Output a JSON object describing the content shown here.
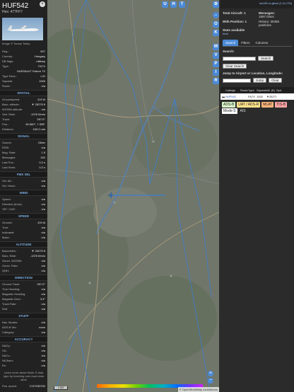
{
  "aircraft": {
    "callsign": "HUF542",
    "hex_line": "Hex:  477FF7",
    "photo_credit": "Image © Tamas Tollay",
    "details": [
      {
        "k": "Reg.:",
        "v": "607"
      },
      {
        "k": "Country:",
        "v": "Hungary"
      },
      {
        "k": "DB flags:",
        "v": "military"
      },
      {
        "k": "Type:",
        "v": "FA7X"
      },
      {
        "k": "",
        "v": "DASSAULT Falcon 7X"
      },
      {
        "k": "Type Desc.:",
        "v": "L3J"
      },
      {
        "k": "Squawk:",
        "v": "1000"
      },
      {
        "k": "Route:",
        "v": "n/a"
      }
    ]
  },
  "sections": [
    {
      "title": "SPATIAL",
      "rows": [
        {
          "k": "Groundspeed:",
          "v": "419 kt"
        },
        {
          "k": "Baro. altitude:",
          "v": "▼ 25275 ft"
        },
        {
          "k": "WGS84 altitude:",
          "v": "n/a"
        },
        {
          "k": "Vert. Rate:",
          "v": "-1376 ft/min"
        },
        {
          "k": "Track:",
          "v": "267.0°"
        },
        {
          "k": "Pos.:",
          "v": "50.560°, 7.305°"
        },
        {
          "k": "Distance:",
          "v": "163.2 nmi"
        }
      ]
    },
    {
      "title": "SIGNAL",
      "rows": [
        {
          "k": "Source:",
          "v": "Other"
        },
        {
          "k": "RSSI:",
          "v": "n/a"
        },
        {
          "k": "Msg. Rate:",
          "v": "1.5"
        },
        {
          "k": "Messages:",
          "v": "152"
        },
        {
          "k": "Last Pos.:",
          "v": "0.2 s"
        },
        {
          "k": "Last Seen:",
          "v": "0.2 s"
        }
      ]
    },
    {
      "title": "FMS SEL",
      "rows": [
        {
          "k": "Sel. Alt.:",
          "v": "n/a"
        },
        {
          "k": "Sel. Head.:",
          "v": "n/a"
        }
      ]
    },
    {
      "title": "WIND",
      "rows": [
        {
          "k": "Speed:",
          "v": "n/a"
        },
        {
          "k": "Direction (from):",
          "v": "n/a"
        },
        {
          "k": "TAT / OAT:",
          "v": "n/a"
        }
      ]
    },
    {
      "title": "SPEED",
      "rows": [
        {
          "k": "Ground:",
          "v": "419 kt"
        },
        {
          "k": "True:",
          "v": "n/a"
        },
        {
          "k": "Indicated:",
          "v": "n/a"
        },
        {
          "k": "Mach:",
          "v": "n/a"
        }
      ]
    },
    {
      "title": "ALTITUDE",
      "rows": [
        {
          "k": "Barometric:",
          "v": "▼ 25275 ft"
        },
        {
          "k": "Baro. Rate:",
          "v": "-1376 ft/min"
        },
        {
          "k": "Geom. WGS84:",
          "v": "n/a"
        },
        {
          "k": "Geom. Rate:",
          "v": "n/a"
        },
        {
          "k": "QNH:",
          "v": "n/a"
        }
      ]
    },
    {
      "title": "DIRECTION",
      "rows": [
        {
          "k": "Ground Track:",
          "v": "267.0°"
        },
        {
          "k": "True Heading:",
          "v": "n/a"
        },
        {
          "k": "Magnetic Heading:",
          "v": "n/a"
        },
        {
          "k": "Magnetic Decl.:",
          "v": "3.3°"
        },
        {
          "k": "Track Rate:",
          "v": "n/a"
        },
        {
          "k": "Roll:",
          "v": "n/a"
        }
      ]
    },
    {
      "title": "STUFF",
      "rows": [
        {
          "k": "Nav. Modes:",
          "v": "n/a"
        },
        {
          "k": "ADS-B Ver.:",
          "v": "none"
        },
        {
          "k": "Category:",
          "v": "n/a"
        }
      ]
    },
    {
      "title": "ACCURACY",
      "rows": [
        {
          "k": "NACp:",
          "v": "n/a"
        },
        {
          "k": "SIL:",
          "v": "n/a"
        },
        {
          "k": "NACv:",
          "v": "n/a"
        },
        {
          "k": "NICbaro:",
          "v": "n/a"
        },
        {
          "k": "Rc:",
          "v": "n/a"
        }
      ]
    }
  ],
  "footer_text": "Learn more about Mode S data type by hovering over each data label",
  "pos_epoch": {
    "k": "Pos. epoch:",
    "v": "1747033792"
  },
  "map": {
    "buttons_top": [
      "U",
      "H",
      "T"
    ],
    "toolbar": [
      "O",
      "K",
      "M",
      "V",
      "P",
      "I",
      "R"
    ],
    "scale_label": "2 NM",
    "attribution": "© OpenStreetMap contributors",
    "zoom_in": "+",
    "zoom_out": "−"
  },
  "sidebar": {
    "version_link": "tar1090 on github (3.14.1733)",
    "total_aircraft_label": "Total Aircraft: 1",
    "with_position_label": "With Position: 1",
    "stats_available": "Stats available",
    "stats_link": "here",
    "messages_label": "Messages:",
    "messages_value": "1597.0/sec",
    "history_label": "History: 30465",
    "history_unit": "positions",
    "tabs": [
      "Search",
      "Filters",
      "Columns"
    ],
    "search_label": "Search:",
    "search_button": "Search",
    "clear_search_button": "Clear Search",
    "jump_label": "Jump to Airport or Location, Longitude:",
    "jump_button": "Jump",
    "clear_button": "Clear",
    "table_headers": [
      "",
      "Callsign",
      "Route",
      "Type",
      "Squawk",
      "Alt. (ft)",
      "Spd"
    ],
    "table_rows": [
      {
        "flag": "",
        "callsign": "HUF542",
        "route": "",
        "type": "FA7X",
        "squawk": "1000",
        "alt": "▼25275",
        "spd": ""
      }
    ],
    "legend": [
      {
        "label": "ADS-B",
        "color": "#d7f4c7"
      },
      {
        "label": "UAT / ADS-R",
        "color": "#ffe28a"
      },
      {
        "label": "MLAT",
        "color": "#ffb57a"
      },
      {
        "label": "TIS-B",
        "color": "#ffa3a3"
      },
      {
        "label": "Mode-S",
        "color": "#ffffff"
      },
      {
        "label": "AIS",
        "color": "#2b2b2b"
      }
    ]
  }
}
